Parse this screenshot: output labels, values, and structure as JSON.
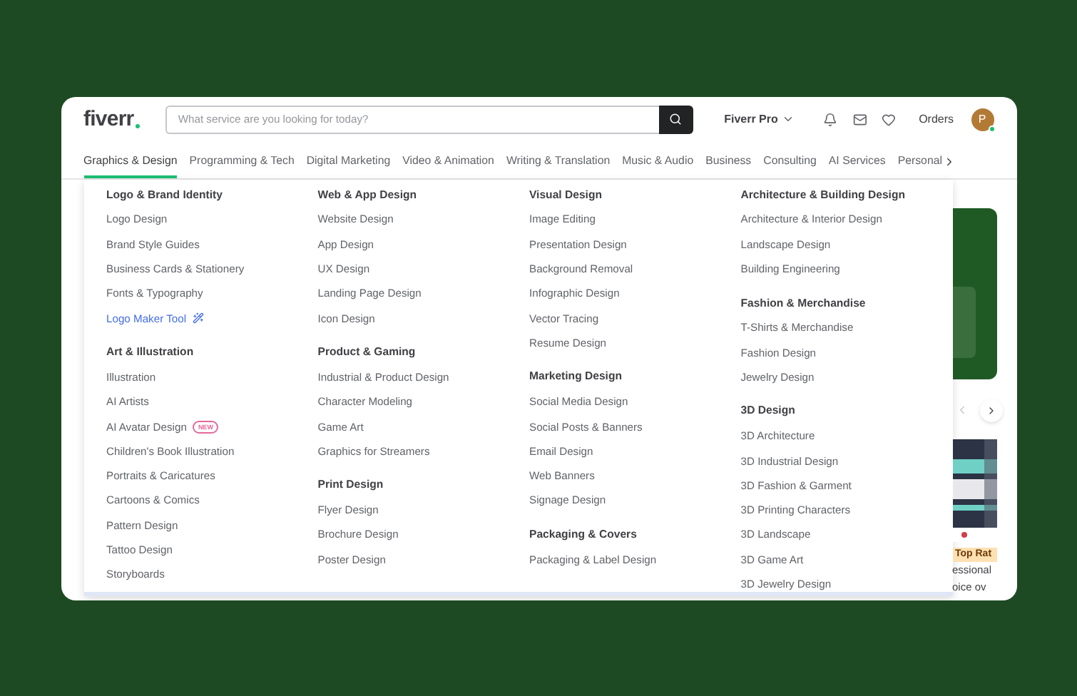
{
  "header": {
    "logo": "fiverr",
    "search": {
      "placeholder": "What service are you looking for today?"
    },
    "pro_menu": "Fiverr Pro",
    "orders": "Orders",
    "avatar": {
      "initial": "P",
      "online": true
    }
  },
  "nav": [
    {
      "label": "Graphics & Design",
      "selected": true
    },
    {
      "label": "Programming & Tech",
      "selected": false
    },
    {
      "label": "Digital Marketing",
      "selected": false
    },
    {
      "label": "Video & Animation",
      "selected": false
    },
    {
      "label": "Writing & Translation",
      "selected": false
    },
    {
      "label": "Music & Audio",
      "selected": false
    },
    {
      "label": "Business",
      "selected": false
    },
    {
      "label": "Consulting",
      "selected": false
    },
    {
      "label": "AI Services",
      "selected": false
    },
    {
      "label": "Personal",
      "selected": false
    }
  ],
  "dropdown": {
    "columns": [
      [
        {
          "title": "Logo & Brand Identity",
          "items": [
            {
              "label": "Logo Design",
              "kind": "link"
            },
            {
              "label": "Brand Style Guides",
              "kind": "link"
            },
            {
              "label": "Business Cards & Stationery",
              "kind": "link"
            },
            {
              "label": "Fonts & Typography",
              "kind": "link"
            },
            {
              "label": "Logo Maker Tool",
              "kind": "tool"
            }
          ]
        },
        {
          "title": "Art & Illustration",
          "items": [
            {
              "label": "Illustration",
              "kind": "link"
            },
            {
              "label": "AI Artists",
              "kind": "link"
            },
            {
              "label": "AI Avatar Design",
              "kind": "link",
              "badge": "NEW"
            },
            {
              "label": "Children's Book Illustration",
              "kind": "link"
            },
            {
              "label": "Portraits & Caricatures",
              "kind": "link"
            },
            {
              "label": "Cartoons & Comics",
              "kind": "link"
            },
            {
              "label": "Pattern Design",
              "kind": "link"
            },
            {
              "label": "Tattoo Design",
              "kind": "link"
            },
            {
              "label": "Storyboards",
              "kind": "link"
            }
          ]
        }
      ],
      [
        {
          "title": "Web & App Design",
          "items": [
            {
              "label": "Website Design",
              "kind": "link"
            },
            {
              "label": "App Design",
              "kind": "link"
            },
            {
              "label": "UX Design",
              "kind": "link"
            },
            {
              "label": "Landing Page Design",
              "kind": "link"
            },
            {
              "label": "Icon Design",
              "kind": "link"
            }
          ]
        },
        {
          "title": "Product & Gaming",
          "items": [
            {
              "label": "Industrial & Product Design",
              "kind": "link"
            },
            {
              "label": "Character Modeling",
              "kind": "link"
            },
            {
              "label": "Game Art",
              "kind": "link"
            },
            {
              "label": "Graphics for Streamers",
              "kind": "link"
            }
          ]
        },
        {
          "title": "Print Design",
          "items": [
            {
              "label": "Flyer Design",
              "kind": "link"
            },
            {
              "label": "Brochure Design",
              "kind": "link"
            },
            {
              "label": "Poster Design",
              "kind": "link"
            }
          ]
        }
      ],
      [
        {
          "title": "Visual Design",
          "items": [
            {
              "label": "Image Editing",
              "kind": "link"
            },
            {
              "label": "Presentation Design",
              "kind": "link"
            },
            {
              "label": "Background Removal",
              "kind": "link"
            },
            {
              "label": "Infographic Design",
              "kind": "link"
            },
            {
              "label": "Vector Tracing",
              "kind": "link"
            },
            {
              "label": "Resume Design",
              "kind": "link"
            }
          ]
        },
        {
          "title": "Marketing Design",
          "items": [
            {
              "label": "Social Media Design",
              "kind": "link"
            },
            {
              "label": "Social Posts & Banners",
              "kind": "link"
            },
            {
              "label": "Email Design",
              "kind": "link"
            },
            {
              "label": "Web Banners",
              "kind": "link"
            },
            {
              "label": "Signage Design",
              "kind": "link"
            }
          ]
        },
        {
          "title": "Packaging & Covers",
          "items": [
            {
              "label": "Packaging & Label Design",
              "kind": "link"
            }
          ]
        }
      ],
      [
        {
          "title": "Architecture & Building Design",
          "items": [
            {
              "label": "Architecture & Interior Design",
              "kind": "link"
            },
            {
              "label": "Landscape Design",
              "kind": "link"
            },
            {
              "label": "Building Engineering",
              "kind": "link"
            }
          ]
        },
        {
          "title": "Fashion & Merchandise",
          "items": [
            {
              "label": "T-Shirts & Merchandise",
              "kind": "link"
            },
            {
              "label": "Fashion Design",
              "kind": "link"
            },
            {
              "label": "Jewelry Design",
              "kind": "link"
            }
          ]
        },
        {
          "title": "3D Design",
          "items": [
            {
              "label": "3D Architecture",
              "kind": "link"
            },
            {
              "label": "3D Industrial Design",
              "kind": "link"
            },
            {
              "label": "3D Fashion & Garment",
              "kind": "link"
            },
            {
              "label": "3D Printing Characters",
              "kind": "link"
            },
            {
              "label": "3D Landscape",
              "kind": "link"
            },
            {
              "label": "3D Game Art",
              "kind": "link"
            },
            {
              "label": "3D Jewelry Design",
              "kind": "link"
            }
          ]
        }
      ]
    ]
  },
  "background_page": {
    "badge": "Top Rat",
    "text_lines": [
      "essional",
      "oice ov"
    ]
  }
}
